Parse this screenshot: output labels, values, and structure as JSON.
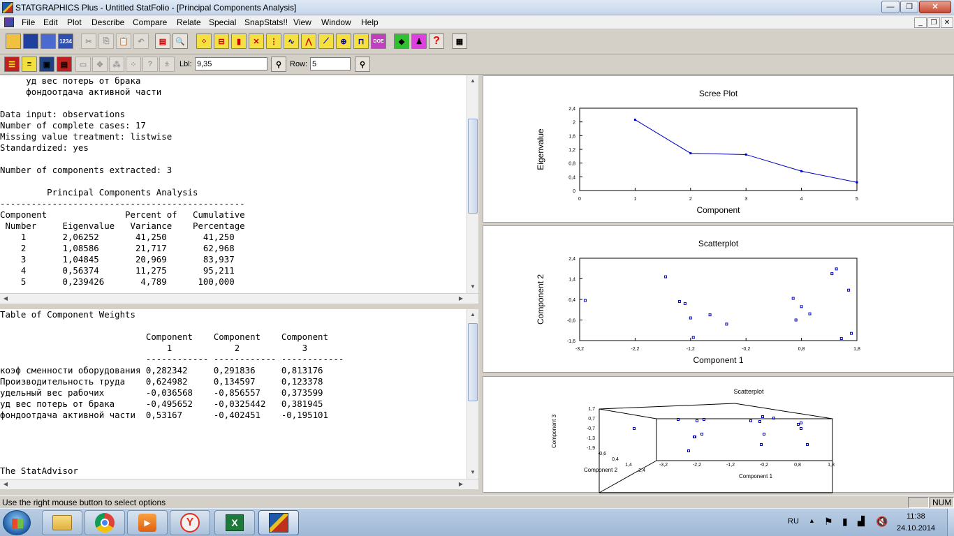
{
  "window": {
    "title": "STATGRAPHICS Plus - Untitled StatFolio - [Principal Components Analysis]",
    "minimize": "—",
    "maximize": "❐",
    "close": "✕"
  },
  "menu": {
    "items": [
      "File",
      "Edit",
      "Plot",
      "Describe",
      "Compare",
      "Relate",
      "Special",
      "SnapStats!!",
      "View",
      "Window",
      "Help"
    ],
    "mdi_min": "_",
    "mdi_restore": "❐",
    "mdi_close": "✕"
  },
  "toolbar2": {
    "lbl_label": "Lbl:",
    "lbl_value": "9,35",
    "row_label": "Row:",
    "row_value": "5"
  },
  "output_top": {
    "lines": [
      "     уд вес потерь от брака",
      "     фондоотдача активной части",
      "",
      "Data input: observations",
      "Number of complete cases: 17",
      "Missing value treatment: listwise",
      "Standardized: yes",
      "",
      "Number of components extracted: 3",
      "",
      "         Principal Components Analysis",
      "-----------------------------------------------",
      "Component               Percent of   Cumulative",
      " Number     Eigenvalue   Variance    Percentage",
      "    1       2,06252       41,250       41,250",
      "    2       1,08586       21,717       62,968",
      "    3       1,04845       20,969       83,937",
      "    4       0,56374       11,275       95,211",
      "    5       0,239426       4,789      100,000"
    ]
  },
  "output_bottom": {
    "lines": [
      "Table of Component Weights",
      "",
      "                            Component    Component    Component",
      "                                1            2            3",
      "                            ------------ ------------ ------------",
      "коэф сменности оборудования 0,282342     0,291836     0,813176",
      "Производительность труда    0,624982     0,134597     0,123378",
      "удельный вес рабочих        -0,036568    -0,856557    0,373599",
      "уд вес потерь от брака      -0,495652    -0,0325442   0,381945",
      "фондоотдача активной части  0,53167      -0,402451    -0,195101",
      "",
      "",
      "",
      "",
      "The StatAdvisor"
    ]
  },
  "status": {
    "message": "Use the right mouse button to select options",
    "num": "NUM"
  },
  "taskbar": {
    "lang": "RU",
    "time": "11:38",
    "date": "24.10.2014"
  },
  "chart_data": [
    {
      "type": "line",
      "title": "Scree Plot",
      "xlabel": "Component",
      "ylabel": "Eigenvalue",
      "xlim": [
        0,
        5
      ],
      "ylim": [
        0,
        2.4
      ],
      "xticks": [
        "0",
        "1",
        "2",
        "3",
        "4",
        "5"
      ],
      "yticks": [
        "0",
        "0,4",
        "0,8",
        "1,2",
        "1,6",
        "2",
        "2,4"
      ],
      "x": [
        1,
        2,
        3,
        4,
        5
      ],
      "y": [
        2.06252,
        1.08586,
        1.04845,
        0.56374,
        0.239426
      ],
      "color": "#0000c0"
    },
    {
      "type": "scatter",
      "title": "Scatterplot",
      "xlabel": "Component 1",
      "ylabel": "Component 2",
      "xlim": [
        -3.2,
        1.8
      ],
      "ylim": [
        -1.6,
        2.4
      ],
      "xticks": [
        "-3,2",
        "-2,2",
        "-1,2",
        "-0,2",
        "0,8",
        "1,8"
      ],
      "yticks": [
        "-1,6",
        "-0,6",
        "0,4",
        "1,4",
        "2,4"
      ],
      "points": [
        [
          -3.1,
          0.35
        ],
        [
          -1.65,
          1.5
        ],
        [
          -1.4,
          0.3
        ],
        [
          -1.3,
          0.2
        ],
        [
          -1.2,
          -0.5
        ],
        [
          -1.15,
          -1.45
        ],
        [
          -0.85,
          -0.35
        ],
        [
          -0.55,
          -0.8
        ],
        [
          0.65,
          0.45
        ],
        [
          0.7,
          -0.6
        ],
        [
          0.8,
          0.05
        ],
        [
          0.95,
          -0.3
        ],
        [
          1.35,
          1.65
        ],
        [
          1.43,
          1.88
        ],
        [
          1.52,
          -1.5
        ],
        [
          1.65,
          0.85
        ],
        [
          1.7,
          -1.25
        ]
      ],
      "color": "#0000c0"
    },
    {
      "type": "scatter",
      "title": "Scatterplot",
      "xlabel": "Component 1",
      "ylabel": "Component 3",
      "zlabel": "Component 2",
      "x_ticks": [
        "-3,2",
        "-2,2",
        "-1,2",
        "-0,2",
        "0,8",
        "1,8"
      ],
      "y_ticks": [
        "-1,9",
        "-1,3",
        "-0,7",
        "0,7",
        "1,7"
      ],
      "z_ticks": [
        "-0,6",
        "0,4",
        "1,4",
        "2,4"
      ],
      "projected": true,
      "color": "#0000c0"
    }
  ]
}
